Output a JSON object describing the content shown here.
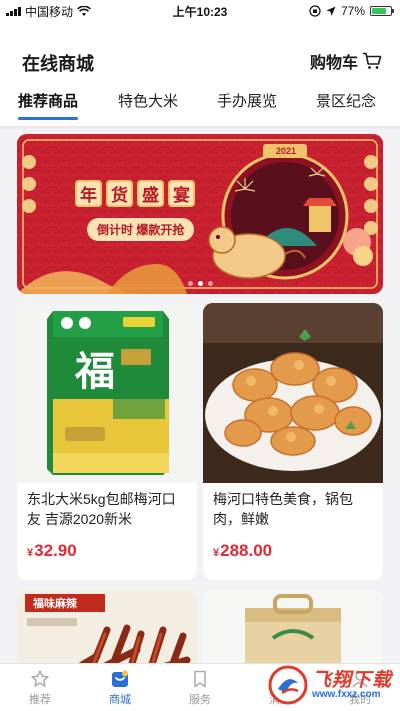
{
  "status_bar": {
    "carrier": "中国移动",
    "time": "上午10:23",
    "battery": "77%",
    "battery_level": 0.77
  },
  "header": {
    "title": "在线商城",
    "cart_label": "购物车"
  },
  "tabs": [
    {
      "label": "推荐商品",
      "active": true
    },
    {
      "label": "特色大米",
      "active": false
    },
    {
      "label": "手办展览",
      "active": false
    },
    {
      "label": "景区纪念",
      "active": false
    }
  ],
  "banner": {
    "title_chars": [
      "年",
      "货",
      "盛",
      "宴"
    ],
    "subtitle": "倒计时 爆款开抢",
    "year": "2021",
    "slide_count": 3,
    "active_slide": 1
  },
  "products": [
    {
      "title": "东北大米5kg包邮梅河口友 吉源2020新米",
      "currency": "¥",
      "price": "32.90",
      "image_icon": "rice-bag-image"
    },
    {
      "title": "梅河口特色美食，锅包肉，鲜嫩",
      "currency": "¥",
      "price": "288.00",
      "image_icon": "fried-pork-image"
    },
    {
      "title": "",
      "currency": "",
      "price": "",
      "image_icon": "spicy-snack-image",
      "tag": "福味麻辣"
    },
    {
      "title": "",
      "currency": "",
      "price": "",
      "image_icon": "rice-box-image"
    }
  ],
  "bottom_nav": [
    {
      "label": "推荐",
      "icon": "star-icon",
      "active": false
    },
    {
      "label": "商城",
      "icon": "shop-icon",
      "active": true
    },
    {
      "label": "服务",
      "icon": "bookmark-icon",
      "active": false
    },
    {
      "label": "消息",
      "icon": "message-icon",
      "active": false
    },
    {
      "label": "我的",
      "icon": "user-icon",
      "active": false
    }
  ],
  "watermark": {
    "main": "飞翔下载",
    "url": "www.fxxz.com"
  },
  "colors": {
    "accent": "#2b6fd6",
    "price": "#e02a36",
    "banner_red": "#c8202e",
    "banner_gold": "#fbe3b6"
  }
}
